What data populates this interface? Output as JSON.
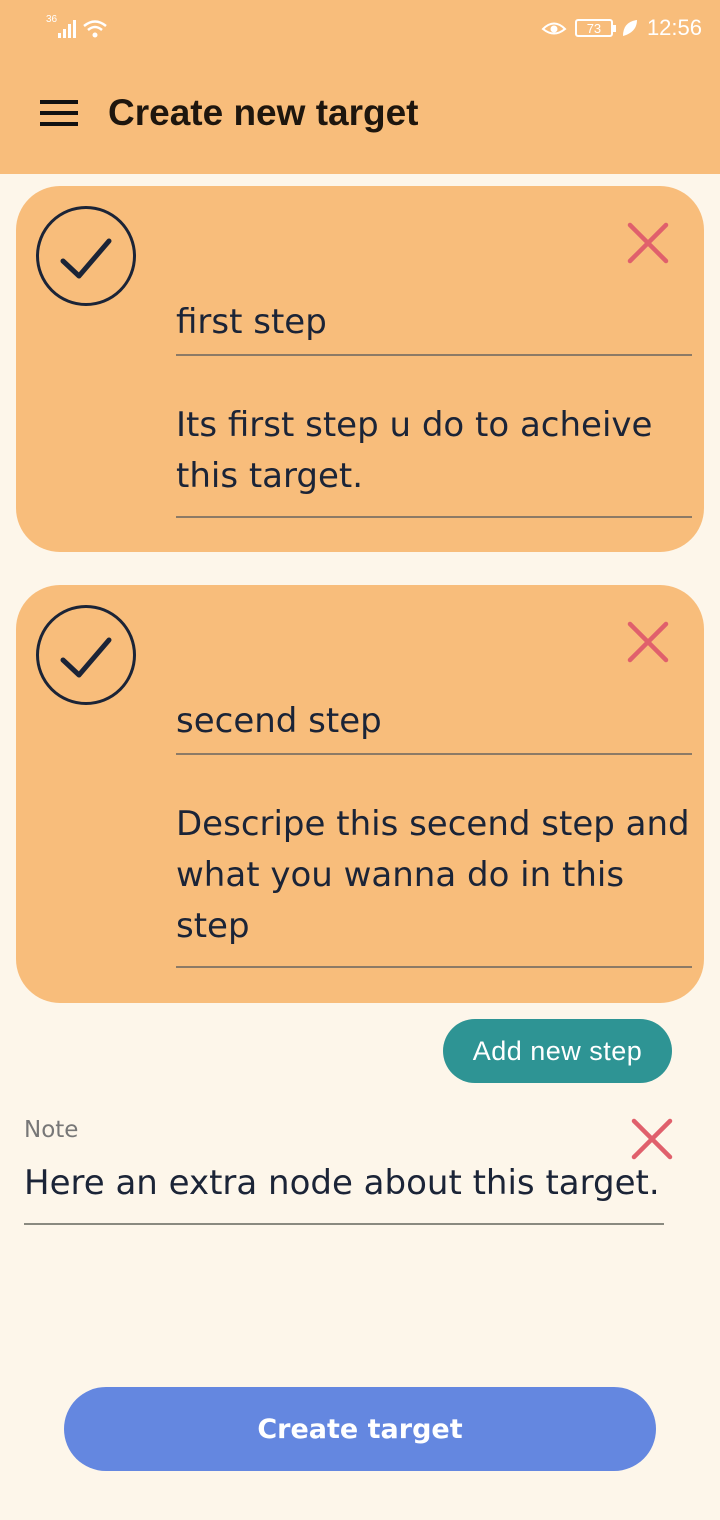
{
  "status_bar": {
    "network": "36",
    "battery": "73",
    "time": "12:56"
  },
  "app_bar": {
    "title": "Create new target",
    "menu_icon": "hamburger-menu-icon"
  },
  "steps": [
    {
      "completed": true,
      "title": "first step",
      "description": "Its first step u do to acheive this target."
    },
    {
      "completed": true,
      "title": "secend step",
      "description": "Descripe this secend step and what you wanna do in this step"
    }
  ],
  "add_step_label": "Add new step",
  "note": {
    "label": "Note",
    "text": "Here an extra node about this target."
  },
  "create_label": "Create target",
  "colors": {
    "header": "#f8bd7b",
    "background": "#fdf6ea",
    "card": "#f8bd7b",
    "text": "#1b2437",
    "delete": "#e0606c",
    "add_step": "#2e9494",
    "create": "#6487e0"
  }
}
